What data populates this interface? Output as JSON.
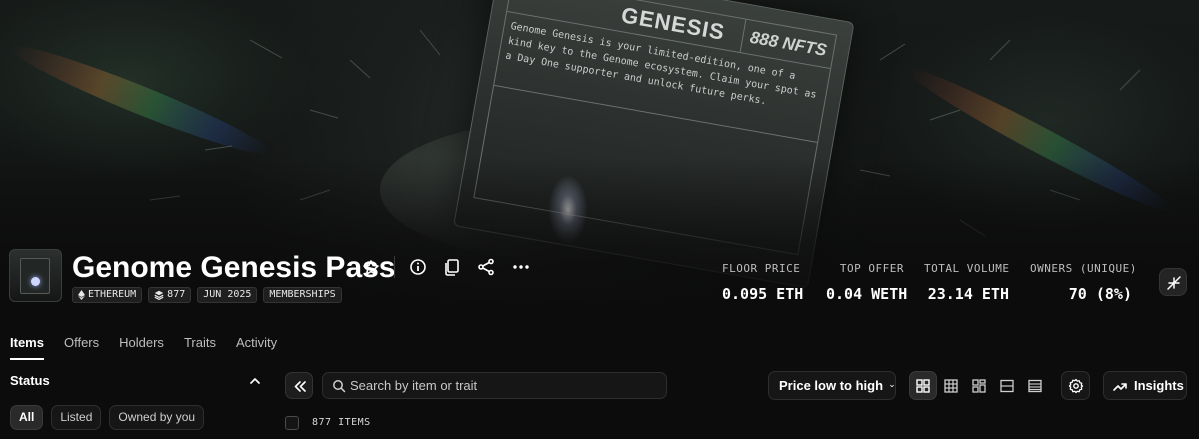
{
  "banner": {
    "card_title": "GENESIS",
    "card_count": "888 NFTS",
    "card_description": "Genome Genesis is your limited-edition, one of a kind key to the Genome ecosystem. Claim your spot as a Day One supporter and unlock future perks."
  },
  "collection": {
    "name": "Genome Genesis Pass",
    "tags": [
      {
        "icon": "ethereum-icon",
        "label": "ETHEREUM"
      },
      {
        "icon": "stack-icon",
        "label": "877"
      },
      {
        "icon": "",
        "label": "JUN 2025"
      },
      {
        "icon": "",
        "label": "MEMBERSHIPS"
      }
    ]
  },
  "stats": [
    {
      "label": "FLOOR PRICE",
      "value": "0.095 ETH"
    },
    {
      "label": "TOP OFFER",
      "value": "0.04 WETH"
    },
    {
      "label": "TOTAL VOLUME",
      "value": "23.14 ETH"
    },
    {
      "label": "OWNERS (UNIQUE)",
      "value": "70 (8%)"
    }
  ],
  "tabs": [
    {
      "label": "Items",
      "active": true
    },
    {
      "label": "Offers"
    },
    {
      "label": "Holders"
    },
    {
      "label": "Traits"
    },
    {
      "label": "Activity"
    }
  ],
  "sidebar": {
    "status_title": "Status",
    "filters": [
      {
        "label": "All",
        "active": true
      },
      {
        "label": "Listed"
      },
      {
        "label": "Owned by you"
      }
    ]
  },
  "toolbar": {
    "search_placeholder": "Search by item or trait",
    "sort_label": "Price low to high",
    "insights_label": "Insights",
    "item_count": "877 ITEMS"
  },
  "colors": {
    "background": "#0c0c0c",
    "surface": "#161616",
    "border": "#2e2e2e",
    "text": "#ffffff",
    "muted": "#bdbdbd"
  }
}
